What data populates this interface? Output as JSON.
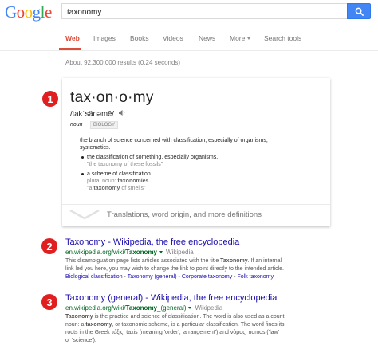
{
  "header": {
    "logo_letters": [
      {
        "ch": "G",
        "color": "#4285f4"
      },
      {
        "ch": "o",
        "color": "#ea4335"
      },
      {
        "ch": "o",
        "color": "#fbbc05"
      },
      {
        "ch": "g",
        "color": "#4285f4"
      },
      {
        "ch": "l",
        "color": "#34a853"
      },
      {
        "ch": "e",
        "color": "#ea4335"
      }
    ],
    "query": "taxonomy"
  },
  "tabs": {
    "web": "Web",
    "images": "Images",
    "books": "Books",
    "videos": "Videos",
    "news": "News",
    "more": "More",
    "tools": "Search tools"
  },
  "stats": "About 92,300,000 results (0.24 seconds)",
  "card": {
    "marker": "1",
    "word": "tax·on·o·my",
    "phonetic": "/takˈsänəmē/",
    "pos": "noun",
    "badge": "BIOLOGY",
    "def_lines": [
      "the branch of science concerned with classification, especially of organisms;",
      "systematics."
    ],
    "bullet1": "the classification of something, especially organisms.",
    "bullet1_ex": "\"the taxonomy of these fossils\"",
    "bullet2": "a scheme of classification.",
    "plural_label": "plural noun:",
    "plural_value": "taxonomies",
    "bullet2_ex_pre": "\"a",
    "bullet2_ex_bold": "taxonomy",
    "bullet2_ex_post": "of smells\"",
    "footer": "Translations, word origin, and more definitions"
  },
  "results": [
    {
      "marker": "2",
      "title": "Taxonomy - Wikipedia, the free encyclopedia",
      "url_pre": "en.wikipedia.org/wiki/",
      "url_bold": "Taxonomy",
      "source": "Wikipedia",
      "snippet": [
        [
          "This disambiguation page lists articles associated with the title ",
          "Taxonomy",
          ". If an internal"
        ],
        [
          "link led you here, you may wish to change the link to point directly to the intended article.",
          "",
          ""
        ]
      ],
      "links": [
        "Biological classification",
        "Taxonomy (general)",
        "Corporate taxonomy",
        "Folk taxonomy"
      ]
    },
    {
      "marker": "3",
      "title": "Taxonomy (general) - Wikipedia, the free encyclopedia",
      "url_pre": "en.wikipedia.org/wiki/",
      "url_bold": "Taxonomy",
      "url_post": "_(general)",
      "source": "Wikipedia",
      "snippet": [
        [
          "",
          "Taxonomy",
          " is the practice and science of classification. The word is also used as a count"
        ],
        [
          "noun: a ",
          "taxonomy",
          ", or taxonomic scheme, is a particular classification. The word finds its"
        ],
        [
          "roots in the Greek τάξις, taxis (meaning 'order', 'arrangement') and νόμος, nomos ('law'",
          "",
          ""
        ],
        [
          "or 'science').",
          "",
          ""
        ]
      ]
    }
  ],
  "colors": {
    "accent_red": "#dd4b39",
    "link_blue": "#1a0dab",
    "url_green": "#006621",
    "search_button": "#4285f4",
    "marker_red": "#e02020"
  }
}
